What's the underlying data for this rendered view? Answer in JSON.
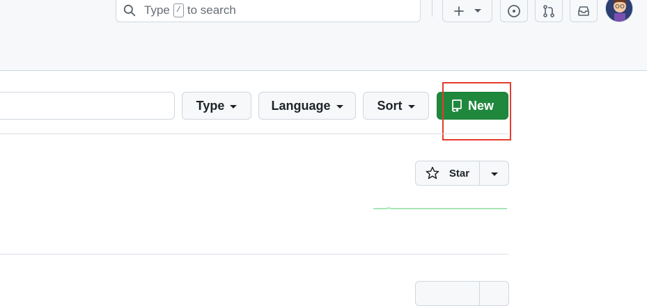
{
  "header": {
    "search": {
      "prefix": "Type",
      "key": "/",
      "suffix": "to search"
    }
  },
  "toolbar": {
    "type_label": "Type",
    "language_label": "Language",
    "sort_label": "Sort",
    "new_label": "New"
  },
  "repos": [
    {
      "star_label": "Star"
    },
    {
      "star_label": ""
    }
  ],
  "colors": {
    "header_bg": "#f6f8fa",
    "primary_button": "#1f883d",
    "highlight_box": "#e53b2c",
    "sparkline": "#a6e6b5"
  }
}
